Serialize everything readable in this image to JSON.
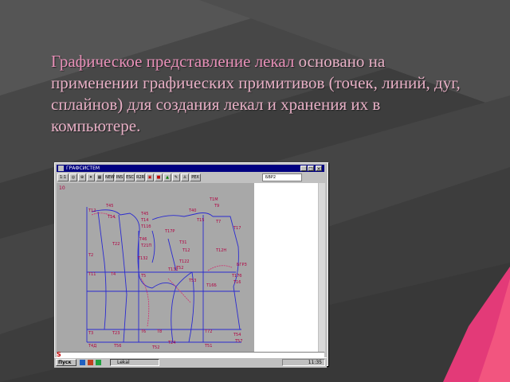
{
  "title": {
    "highlight": "Графическое представление лекал",
    "rest": " основано на применении графических примитивов (точек, линий, дуг, сплайнов) для создания лекал и хранения их в компьютере."
  },
  "app_window": {
    "title": "ГРАФСИСТЕМ",
    "toolbar": {
      "zoom_label": "1:1",
      "buttons": [
        "NEW",
        "INS",
        "ESC",
        "R2R",
        "РЕХ"
      ],
      "field_value": "БВР2"
    },
    "canvas_label": "10",
    "pattern_labels": [
      "Т12",
      "Т45",
      "Т45",
      "Т14",
      "Т14",
      "Т1М",
      "Т9",
      "Т7",
      "Т40",
      "Т15",
      "Т17",
      "Т17Р",
      "Т11б",
      "Т46",
      "Т31",
      "Т22",
      "Т12",
      "Т12Н",
      "Т21П",
      "Т2",
      "Т132",
      "Т122",
      "Т131",
      "Т52",
      "Т53",
      "БГРЗ",
      "Т11",
      "Т4",
      "Т5",
      "Т17б",
      "Т16",
      "Т16Б",
      "Т3",
      "Т23",
      "Т6",
      "Т8",
      "Т24",
      "Т4Д",
      "Т72",
      "Т51",
      "Т54",
      "Т57",
      "Т56",
      "Т52"
    ],
    "command_symbol": "S"
  },
  "taskbar": {
    "start_label": "Пуск",
    "task_label": "Lekal",
    "clock": "11:35"
  },
  "colors": {
    "title_text": "#e8b0c6",
    "title_highlight": "#e890b8",
    "pattern_lines": "#2a2ad0",
    "pattern_labels": "#b00040",
    "pink_shape": "#e0306a"
  }
}
